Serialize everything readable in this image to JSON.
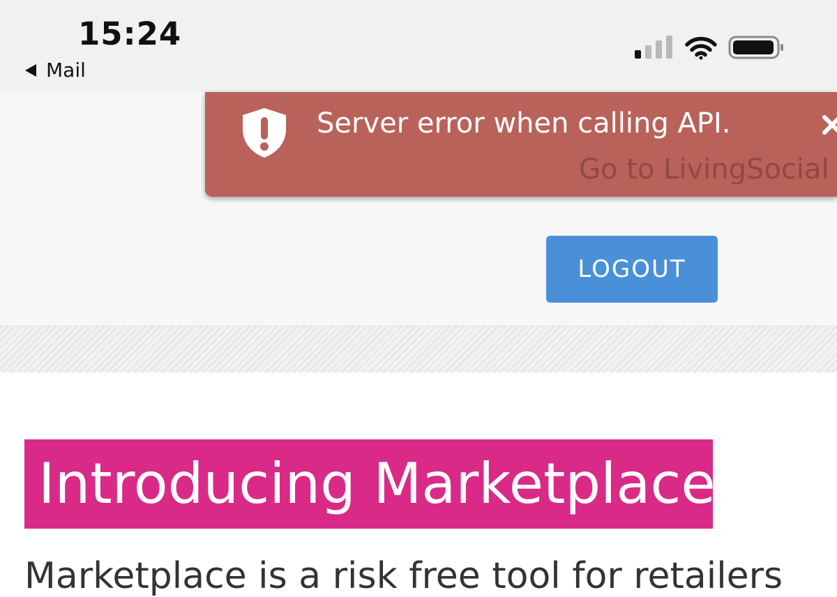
{
  "status_bar": {
    "time": "15:24",
    "back_label": "Mail",
    "icons": [
      "signal-icon",
      "wifi-icon",
      "battery-icon"
    ]
  },
  "error_toast": {
    "message": "Server error when calling API.",
    "link_text": "Go to LivingSocial",
    "icon": "shield-exclamation-icon",
    "close_icon": "close-icon",
    "background_color": "#b9625a"
  },
  "header": {
    "logout_label": "LOGOUT",
    "logout_color": "#4a90d9"
  },
  "content": {
    "heading": "Introducing Marketplace",
    "heading_color": "#d92a88",
    "body_text": "Marketplace is a risk free tool for retailers"
  }
}
